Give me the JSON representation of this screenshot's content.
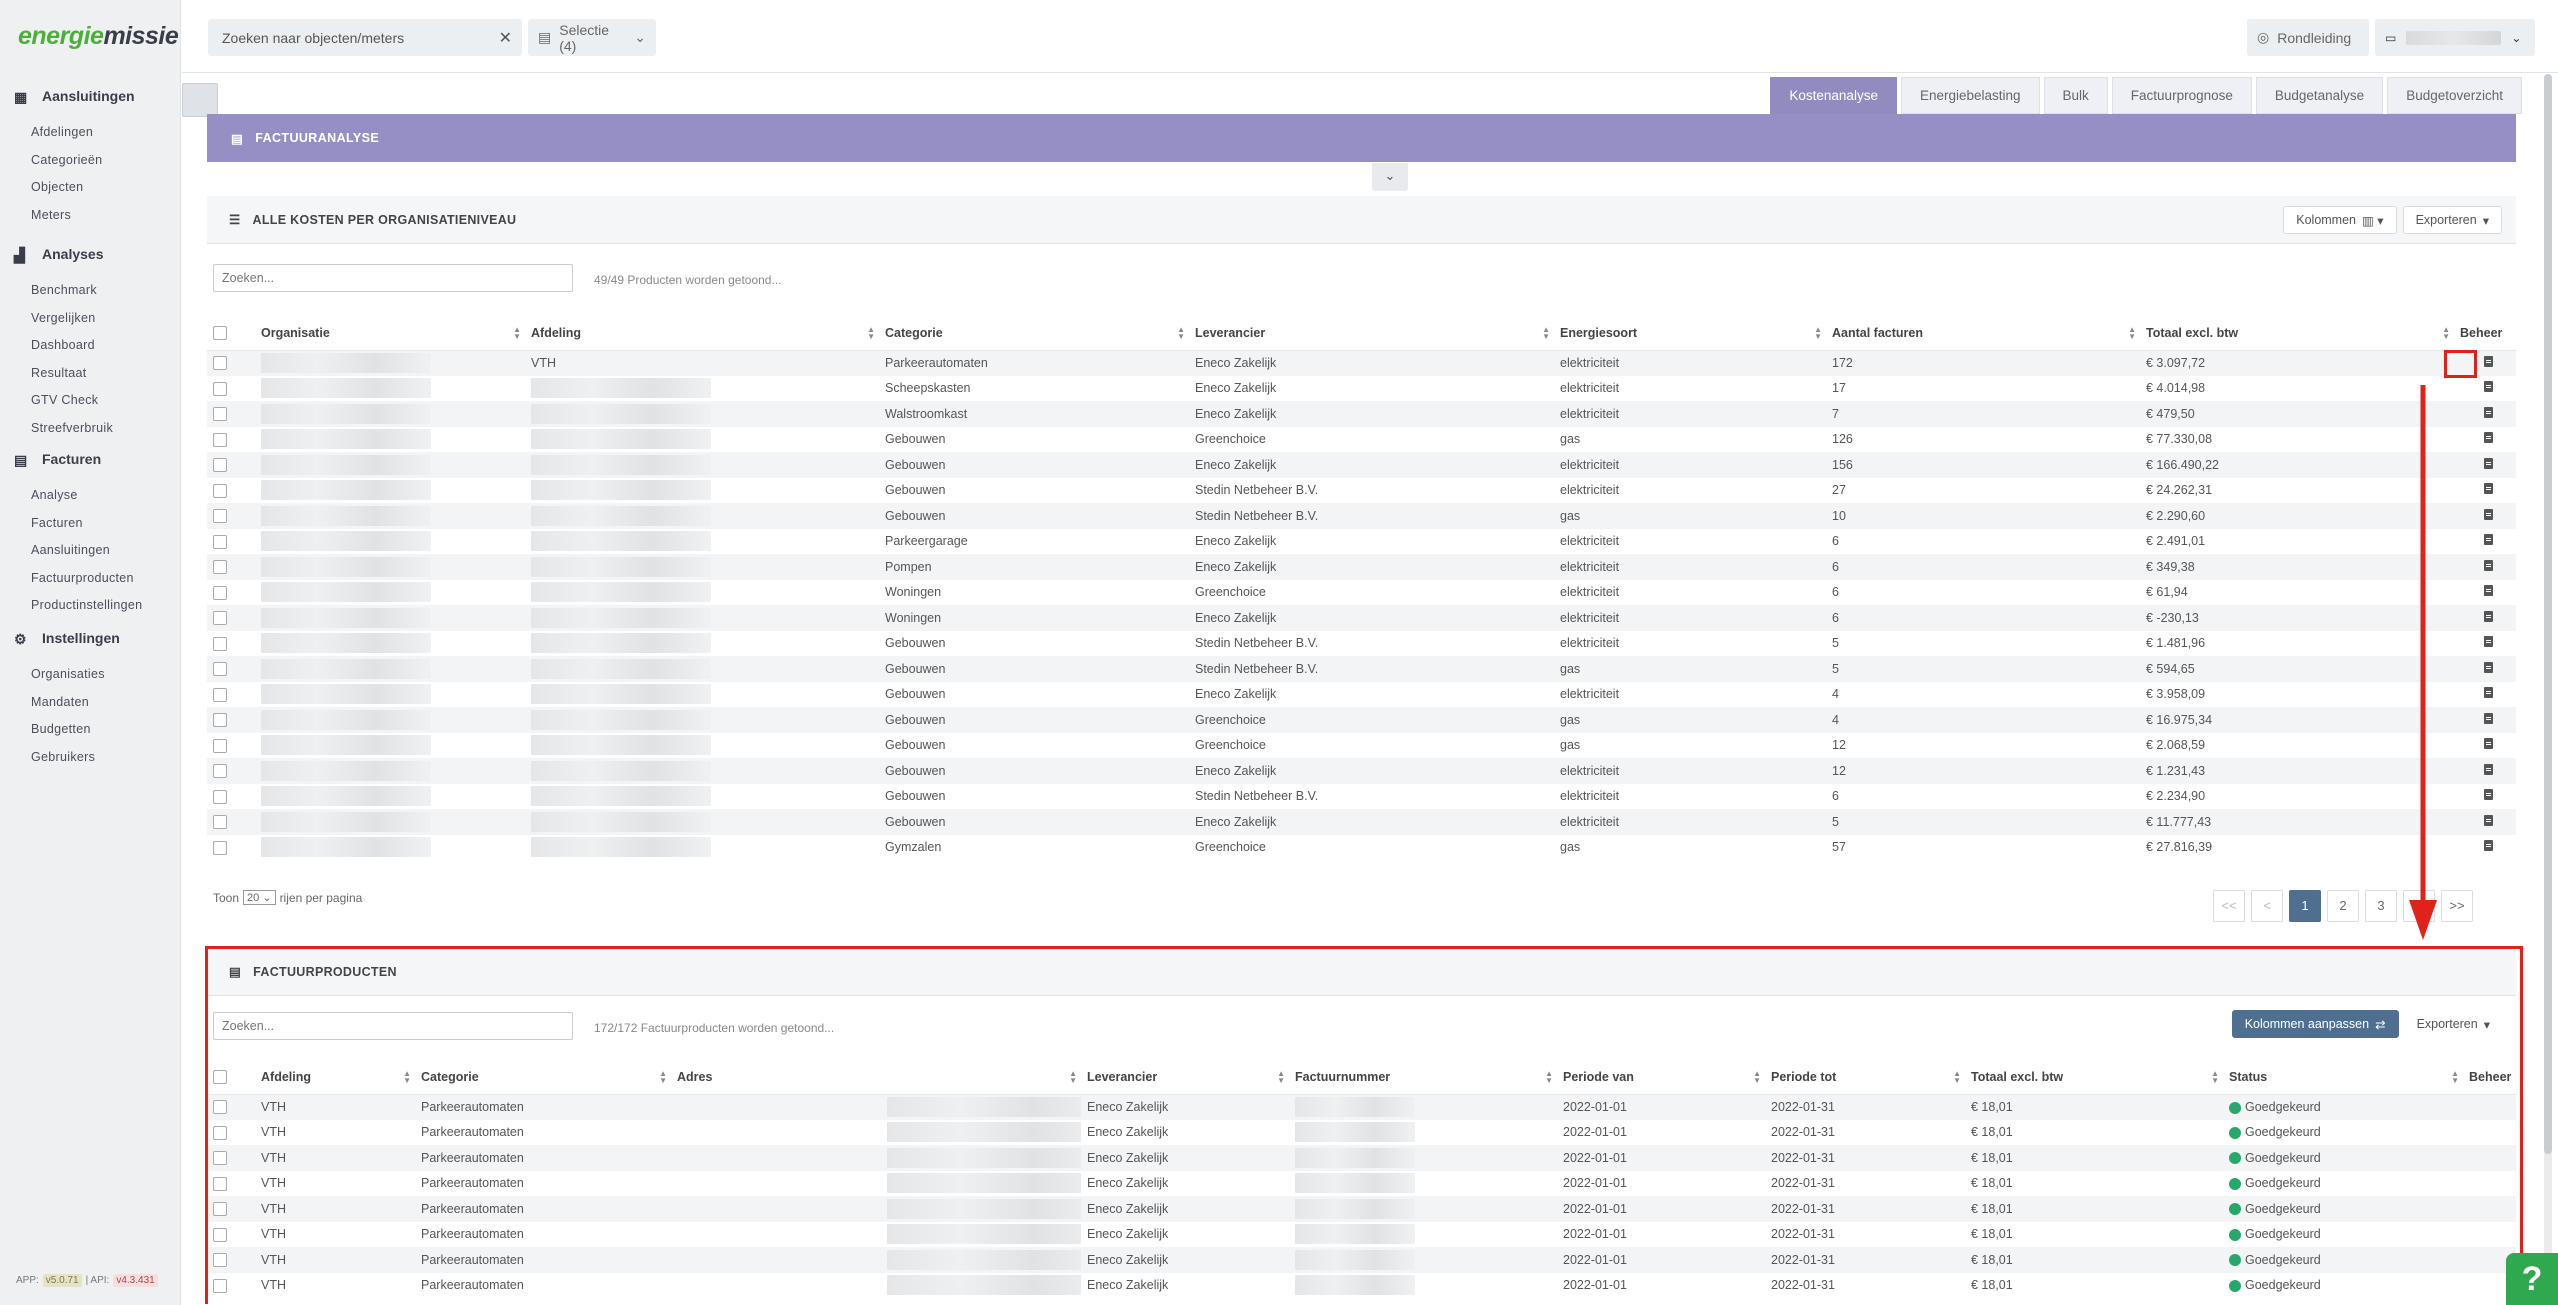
{
  "app": {
    "logo_green": "energie",
    "logo_dark": "missie"
  },
  "sidebar": {
    "sections": [
      {
        "title": "Aansluitingen",
        "icon": "building-icon",
        "items": [
          "Afdelingen",
          "Categorieën",
          "Objecten",
          "Meters"
        ]
      },
      {
        "title": "Analyses",
        "icon": "chart-icon",
        "items": [
          "Benchmark",
          "Vergelijken",
          "Dashboard",
          "Resultaat",
          "GTV Check",
          "Streefverbruik"
        ]
      },
      {
        "title": "Facturen",
        "icon": "invoice-icon",
        "items": [
          "Analyse",
          "Facturen",
          "Aansluitingen",
          "Factuurproducten",
          "Productinstellingen"
        ]
      },
      {
        "title": "Instellingen",
        "icon": "gears-icon",
        "items": [
          "Organisaties",
          "Mandaten",
          "Budgetten",
          "Gebruikers"
        ]
      }
    ],
    "version": {
      "app_label": "APP:",
      "app_version": "v5.0.71",
      "sep": "| API:",
      "api_version": "v4.3.431"
    }
  },
  "topbar": {
    "search_label": "Zoeken naar objecten/meters",
    "selection_label": "Selectie (4)",
    "tour_label": "Rondleiding"
  },
  "tabs": [
    "Kostenanalyse",
    "Energiebelasting",
    "Bulk",
    "Factuurprognose",
    "Budgetanalyse",
    "Budgetoverzicht"
  ],
  "active_tab": "Kostenanalyse",
  "factuuranalyse": {
    "title": "FACTUURANALYSE"
  },
  "costs_panel": {
    "title": "ALLE KOSTEN PER ORGANISATIENIVEAU",
    "columns_button": "Kolommen",
    "export_button": "Exporteren",
    "search_placeholder": "Zoeken...",
    "count_text": "49/49 Producten worden getoond...",
    "headers": [
      "Organisatie",
      "Afdeling",
      "Categorie",
      "Leverancier",
      "Energiesoort",
      "Aantal facturen",
      "Totaal excl. btw",
      "Beheer"
    ],
    "rows": [
      [
        "",
        "VTH",
        "Parkeerautomaten",
        "Eneco Zakelijk",
        "elektriciteit",
        "172",
        "€ 3.097,72"
      ],
      [
        "",
        "",
        "Scheepskasten",
        "Eneco Zakelijk",
        "elektriciteit",
        "17",
        "€ 4.014,98"
      ],
      [
        "",
        "",
        "Walstroomkast",
        "Eneco Zakelijk",
        "elektriciteit",
        "7",
        "€ 479,50"
      ],
      [
        "",
        "",
        "Gebouwen",
        "Greenchoice",
        "gas",
        "126",
        "€ 77.330,08"
      ],
      [
        "",
        "",
        "Gebouwen",
        "Eneco Zakelijk",
        "elektriciteit",
        "156",
        "€ 166.490,22"
      ],
      [
        "",
        "",
        "Gebouwen",
        "Stedin Netbeheer B.V.",
        "elektriciteit",
        "27",
        "€ 24.262,31"
      ],
      [
        "",
        "",
        "Gebouwen",
        "Stedin Netbeheer B.V.",
        "gas",
        "10",
        "€ 2.290,60"
      ],
      [
        "",
        "",
        "Parkeergarage",
        "Eneco Zakelijk",
        "elektriciteit",
        "6",
        "€ 2.491,01"
      ],
      [
        "",
        "",
        "Pompen",
        "Eneco Zakelijk",
        "elektriciteit",
        "6",
        "€ 349,38"
      ],
      [
        "",
        "",
        "Woningen",
        "Greenchoice",
        "elektriciteit",
        "6",
        "€ 61,94"
      ],
      [
        "",
        "",
        "Woningen",
        "Eneco Zakelijk",
        "elektriciteit",
        "6",
        "€ -230,13"
      ],
      [
        "",
        "",
        "Gebouwen",
        "Stedin Netbeheer B.V.",
        "elektriciteit",
        "5",
        "€ 1.481,96"
      ],
      [
        "",
        "",
        "Gebouwen",
        "Stedin Netbeheer B.V.",
        "gas",
        "5",
        "€ 594,65"
      ],
      [
        "",
        "",
        "Gebouwen",
        "Eneco Zakelijk",
        "elektriciteit",
        "4",
        "€ 3.958,09"
      ],
      [
        "",
        "",
        "Gebouwen",
        "Greenchoice",
        "gas",
        "4",
        "€ 16.975,34"
      ],
      [
        "",
        "",
        "Gebouwen",
        "Greenchoice",
        "gas",
        "12",
        "€ 2.068,59"
      ],
      [
        "",
        "",
        "Gebouwen",
        "Eneco Zakelijk",
        "elektriciteit",
        "12",
        "€ 1.231,43"
      ],
      [
        "",
        "",
        "Gebouwen",
        "Stedin Netbeheer B.V.",
        "elektriciteit",
        "6",
        "€ 2.234,90"
      ],
      [
        "",
        "",
        "Gebouwen",
        "Eneco Zakelijk",
        "elektriciteit",
        "5",
        "€ 11.777,43"
      ],
      [
        "",
        "",
        "Gymzalen",
        "Greenchoice",
        "gas",
        "57",
        "€ 27.816,39"
      ]
    ],
    "rows_per_page_prefix": "Toon",
    "rows_per_page_value": "20",
    "rows_per_page_suffix": "rijen per pagina",
    "pagination": [
      "<<",
      "<",
      "1",
      "2",
      "3",
      ">",
      ">>"
    ],
    "current_page": "1"
  },
  "products_panel": {
    "title": "FACTUURPRODUCTEN",
    "adjust_columns_button": "Kolommen aanpassen",
    "export_button": "Exporteren",
    "search_placeholder": "Zoeken...",
    "count_text": "172/172 Factuurproducten worden getoond...",
    "headers": [
      "Afdeling",
      "Categorie",
      "Adres",
      "Leverancier",
      "Factuurnummer",
      "Periode van",
      "Periode tot",
      "Totaal excl. btw",
      "Status",
      "Beheer"
    ],
    "rows": [
      [
        "VTH",
        "Parkeerautomaten",
        "",
        "Eneco Zakelijk",
        "",
        "2022-01-01",
        "2022-01-31",
        "€ 18,01",
        "Goedgekeurd"
      ],
      [
        "VTH",
        "Parkeerautomaten",
        "",
        "Eneco Zakelijk",
        "",
        "2022-01-01",
        "2022-01-31",
        "€ 18,01",
        "Goedgekeurd"
      ],
      [
        "VTH",
        "Parkeerautomaten",
        "",
        "Eneco Zakelijk",
        "",
        "2022-01-01",
        "2022-01-31",
        "€ 18,01",
        "Goedgekeurd"
      ],
      [
        "VTH",
        "Parkeerautomaten",
        "",
        "Eneco Zakelijk",
        "",
        "2022-01-01",
        "2022-01-31",
        "€ 18,01",
        "Goedgekeurd"
      ],
      [
        "VTH",
        "Parkeerautomaten",
        "",
        "Eneco Zakelijk",
        "",
        "2022-01-01",
        "2022-01-31",
        "€ 18,01",
        "Goedgekeurd"
      ],
      [
        "VTH",
        "Parkeerautomaten",
        "",
        "Eneco Zakelijk",
        "",
        "2022-01-01",
        "2022-01-31",
        "€ 18,01",
        "Goedgekeurd"
      ],
      [
        "VTH",
        "Parkeerautomaten",
        "",
        "Eneco Zakelijk",
        "",
        "2022-01-01",
        "2022-01-31",
        "€ 18,01",
        "Goedgekeurd"
      ],
      [
        "VTH",
        "Parkeerautomaten",
        "",
        "Eneco Zakelijk",
        "",
        "2022-01-01",
        "2022-01-31",
        "€ 18,01",
        "Goedgekeurd"
      ]
    ]
  },
  "colors": {
    "accent_purple": "#968fc5",
    "active_tab": "#918bbf",
    "primary_button": "#4f6f91",
    "status_green": "#27a86b",
    "annotation_red": "#e0221b",
    "brand_green": "#4caf3c"
  }
}
